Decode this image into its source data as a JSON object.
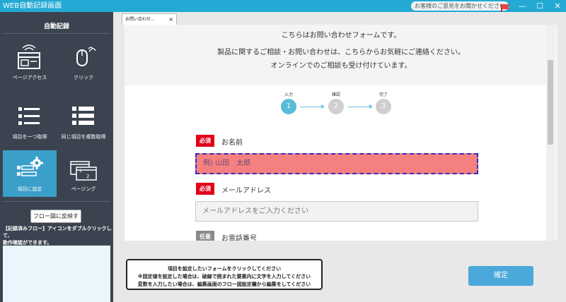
{
  "window": {
    "title": "WEB自動記録画面",
    "feedback_label": "お客様のご意見をお聞かせください",
    "minimize": "—",
    "maximize": "☐",
    "close": "✕"
  },
  "sidebar": {
    "heading": "自動記録",
    "tools": [
      {
        "label": "ページアクセス",
        "icon": "page-access-icon"
      },
      {
        "label": "クリック",
        "icon": "mouse-click-icon"
      },
      {
        "label": "項目を一つ取得",
        "icon": "list-single-icon"
      },
      {
        "label": "同じ項目を複数取得",
        "icon": "list-multiple-icon"
      },
      {
        "label": "項目に設定",
        "icon": "form-settings-icon",
        "active": true
      },
      {
        "label": "ページング",
        "icon": "paging-icon"
      }
    ],
    "reflect_button": "フロー図に反映する",
    "hint_line1": "【記録済みフロー】アイコンをダブルクリックして、",
    "hint_line2": "動作確認ができます。"
  },
  "browser": {
    "tab_label": "お問い合わせ...",
    "tab_close": "×",
    "intro_lines": [
      "こちらはお問い合わせフォームです。",
      "製品に関するご相談・お問い合わせは、こちらからお気軽にご連絡ください。",
      "オンラインでのご相談も受け付けています。"
    ],
    "steps": [
      {
        "label": "入力",
        "number": "1"
      },
      {
        "label": "確認",
        "number": "2"
      },
      {
        "label": "完了",
        "number": "3"
      }
    ],
    "fields": [
      {
        "badge": "必須",
        "label": "お名前",
        "placeholder": "例) 山田　太郎"
      },
      {
        "badge": "必須",
        "label": "メールアドレス",
        "placeholder": "メールアドレスをご入力ください"
      },
      {
        "badge": "任意",
        "label": "お電話番号"
      }
    ]
  },
  "bottom": {
    "notice_lines": [
      "項目を設定したいフォームをクリックしてください",
      "※固定値を設定した場合は、破線で囲まれた要素内に文字を入力してください",
      "変数を入力したい場合は、編集画面のフロー図設定欄から編集をしてください"
    ],
    "confirm_button": "確定"
  },
  "colors": {
    "titlebar": "#23a9d3",
    "sidebar": "#3b4350",
    "active_tool": "#3a9fc9",
    "step_active": "#5bbcd9",
    "step_inactive": "#cfcfcf",
    "required_badge": "#e0001b",
    "optional_badge": "#8a8a8a",
    "highlight_field": "#f58080",
    "highlight_border": "#3030c0",
    "confirm_button": "#4ba8da"
  }
}
